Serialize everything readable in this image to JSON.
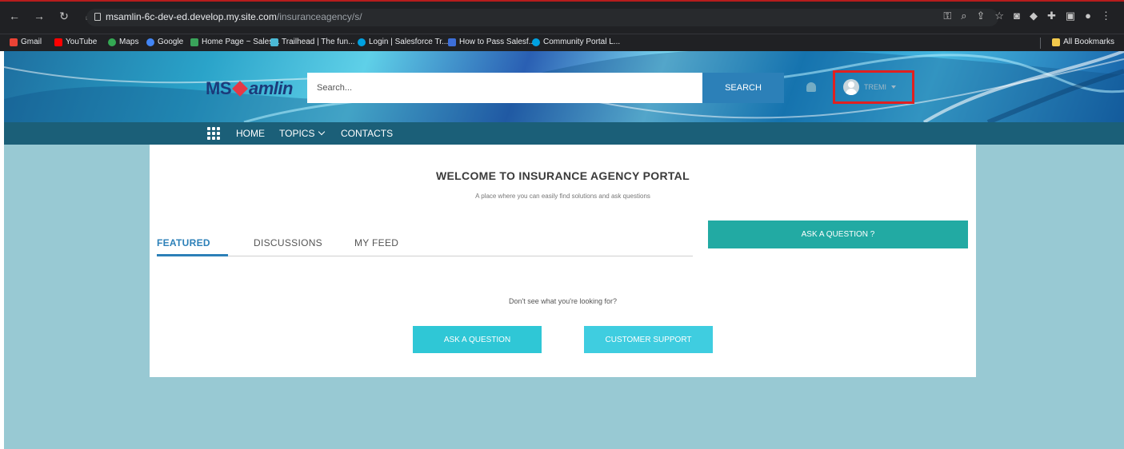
{
  "browser": {
    "url_host": "msamlin-6c-dev-ed.develop.my.site.com",
    "url_path": "/insuranceagency/s/",
    "bookmarks": [
      {
        "label": "Gmail",
        "color": "#ea4335"
      },
      {
        "label": "YouTube",
        "color": "#ff0000"
      },
      {
        "label": "Maps",
        "color": "#34a853"
      },
      {
        "label": "Google",
        "color": "#4285f4"
      },
      {
        "label": "Home Page ~ Sales...",
        "color": "#3aa35a"
      },
      {
        "label": "Trailhead | The fun...",
        "color": "#4bb8d4"
      },
      {
        "label": "Login | Salesforce Tr...",
        "color": "#00a1e0"
      },
      {
        "label": "How to Pass Salesf...",
        "color": "#3d6fd8"
      },
      {
        "label": "Community Portal L...",
        "color": "#00a1e0"
      }
    ],
    "all_bookmarks": "All Bookmarks"
  },
  "header": {
    "logo_ms": "MS",
    "logo_amlin": "amlin",
    "search_placeholder": "Search...",
    "search_button": "SEARCH",
    "user_name": "TREMI"
  },
  "nav": {
    "items": [
      "HOME",
      "TOPICS",
      "CONTACTS"
    ]
  },
  "main": {
    "title": "WELCOME TO INSURANCE AGENCY PORTAL",
    "tagline": "A place where you can easily find solutions and ask questions",
    "tabs": [
      "FEATURED",
      "DISCUSSIONS",
      "MY FEED"
    ],
    "ask_question_top": "ASK A QUESTION ?",
    "not_found": "Don't see what you're looking for?",
    "ask_question": "ASK A QUESTION",
    "customer_support": "CUSTOMER SUPPORT"
  },
  "colors": {
    "page_bg": "#98c9d3",
    "nav_bg": "#1b5f78",
    "accent": "#2c80b8",
    "teal": "#22aaa3"
  }
}
